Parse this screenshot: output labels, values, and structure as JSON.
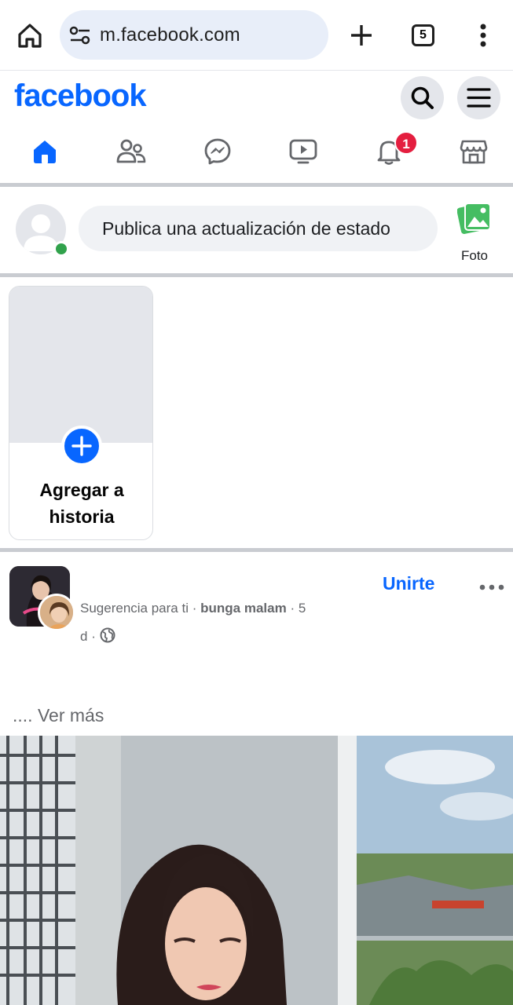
{
  "browser": {
    "url": "m.facebook.com",
    "tab_count": "5"
  },
  "header": {
    "logo": "facebook"
  },
  "nav": {
    "items": [
      {
        "name": "home"
      },
      {
        "name": "friends"
      },
      {
        "name": "messenger"
      },
      {
        "name": "video"
      },
      {
        "name": "notifications",
        "badge": "1"
      },
      {
        "name": "marketplace"
      }
    ]
  },
  "composer": {
    "placeholder": "Publica una actualización de estado",
    "photo_label": "Foto"
  },
  "stories": {
    "add_label_line1": "Agregar a",
    "add_label_line2": "historia"
  },
  "post": {
    "join_label": "Unirte",
    "suggestion": "Sugerencia para ti",
    "group_name": "bunga malam",
    "time_part1": "5",
    "time_part2": "d",
    "see_more": ".... Ver más"
  },
  "colors": {
    "brand": "#0866ff",
    "badge": "#e41e3f",
    "online": "#31a24c"
  }
}
